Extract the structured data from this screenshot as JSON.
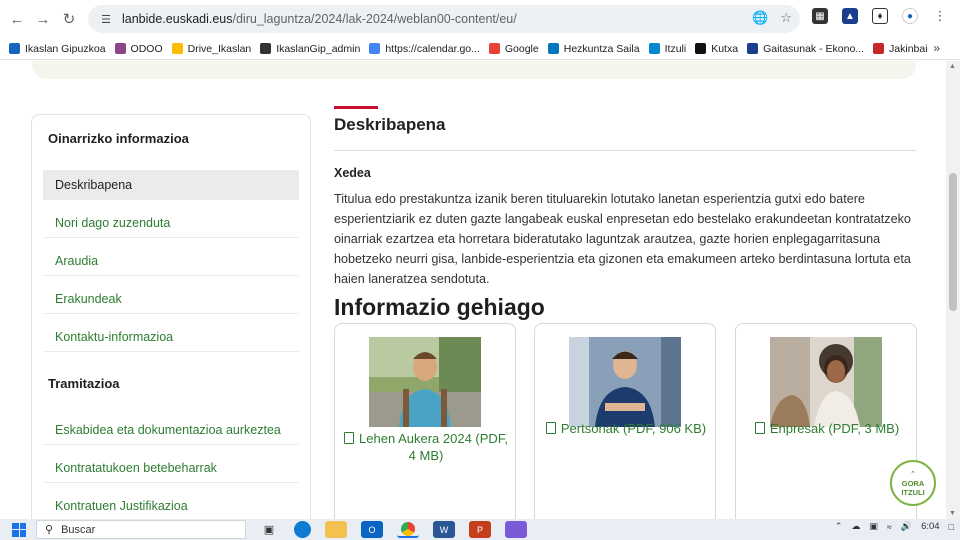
{
  "browser": {
    "url_host": "lanbide.euskadi.eus",
    "url_path": "/diru_laguntza/2024/lak-2024/weblan00-content/eu/"
  },
  "bookmarks": [
    {
      "label": "Ikaslan Gipuzkoa",
      "color": "#1565c0"
    },
    {
      "label": "ODOO",
      "color": "#8e4585"
    },
    {
      "label": "Drive_Ikaslan",
      "color": "#fbbc04"
    },
    {
      "label": "IkaslanGip_admin",
      "color": "#333333"
    },
    {
      "label": "https://calendar.go...",
      "color": "#4285f4"
    },
    {
      "label": "Google",
      "color": "#ea4335"
    },
    {
      "label": "Hezkuntza Saila",
      "color": "#0277bd"
    },
    {
      "label": "Itzuli",
      "color": "#0288d1"
    },
    {
      "label": "Kutxa",
      "color": "#111111"
    },
    {
      "label": "Gaitasunak - Ekono...",
      "color": "#1a3e8c"
    },
    {
      "label": "Jakinbai",
      "color": "#c62828"
    }
  ],
  "sidebar": {
    "section1_title": "Oinarrizko informazioa",
    "section1_items": [
      "Deskribapena",
      "Nori dago zuzenduta",
      "Araudia",
      "Erakundeak",
      "Kontaktu-informazioa"
    ],
    "section2_title": "Tramitazioa",
    "section2_items": [
      "Eskabidea eta dokumentazioa aurkeztea",
      "Kontratatukoen betebeharrak",
      "Kontratuen Justifikazioa"
    ]
  },
  "content": {
    "title": "Deskribapena",
    "subtitle": "Xedea",
    "body": "Titulua edo prestakuntza izanik beren tituluarekin lotutako lanetan esperientzia gutxi edo batere esperientziarik ez duten gazte langabeak euskal enpresetan edo bestelako erakundeetan kontratatzeko oinarriak ezartzea eta horretara bideratutako laguntzak arautzea, gazte horien enplegagarritasuna hobetzeko neurri gisa, lanbide-esperientzia eta gizonen eta emakumeen arteko berdintasuna lortuta eta haien laneratzea sendotuta.",
    "more_title": "Informazio gehiago",
    "cards": [
      {
        "label": "Lehen Aukera 2024 (PDF, 4 MB)"
      },
      {
        "label": "Pertsonak (PDF, 906 KB)"
      },
      {
        "label": "Enpresak (PDF, 3 MB)"
      }
    ]
  },
  "back_to_top": {
    "line1": "GORA",
    "line2": "ITZULI"
  },
  "taskbar": {
    "search_placeholder": "Buscar",
    "time": "6:04"
  }
}
